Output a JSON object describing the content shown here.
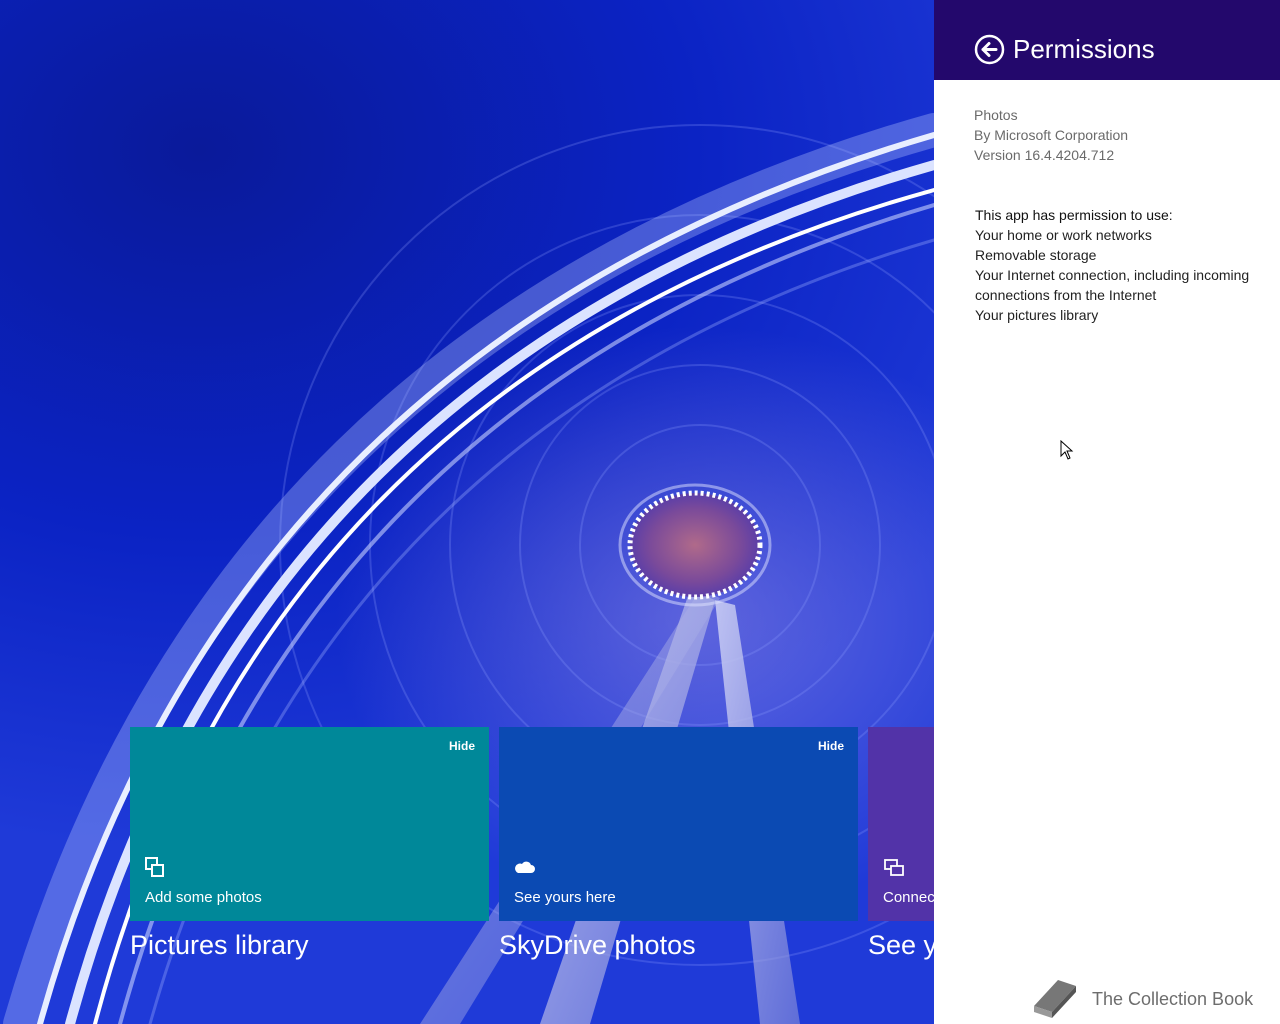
{
  "background": {
    "colors": {
      "sky": "#0b22b8",
      "ring_light": "#dfe6ff",
      "hub_glow": "#ffffff"
    }
  },
  "tiles": [
    {
      "hide_label": "Hide",
      "icon": "collection-icon",
      "label": "Add some photos",
      "caption": "Pictures library",
      "color": "#008899"
    },
    {
      "hide_label": "Hide",
      "icon": "cloud-icon",
      "label": "See yours here",
      "caption": "SkyDrive photos",
      "color": "#0b4ab3"
    },
    {
      "hide_label": "",
      "icon": "devices-icon",
      "label": "Connec",
      "caption": "See yo",
      "color": "#5233a8"
    }
  ],
  "panel": {
    "title": "Permissions",
    "header_color": "#23086c",
    "back_icon": "back-arrow-icon",
    "app": {
      "name": "Photos",
      "publisher": "By Microsoft Corporation",
      "version": "Version 16.4.4204.712"
    },
    "permissions": {
      "heading": "This app has permission to use:",
      "items": [
        "Your home or work networks",
        "Removable storage",
        "Your Internet connection, including incoming connections from the Internet",
        "Your pictures library"
      ]
    }
  },
  "watermark": {
    "text": "The Collection Book",
    "icon": "book-icon"
  }
}
